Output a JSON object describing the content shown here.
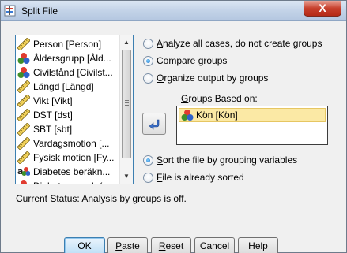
{
  "window": {
    "title": "Split File",
    "close_glyph": "X",
    "icon": "split-file-app-icon"
  },
  "variables": {
    "items": [
      {
        "label": "Person [Person]",
        "icon": "scale-ruler-icon"
      },
      {
        "label": "Åldersgrupp [Åld...",
        "icon": "nominal-icon"
      },
      {
        "label": "Civilstånd [Civilst...",
        "icon": "nominal-icon"
      },
      {
        "label": "Längd [Längd]",
        "icon": "scale-ruler-icon"
      },
      {
        "label": "Vikt [Vikt]",
        "icon": "scale-ruler-icon"
      },
      {
        "label": "DST [dst]",
        "icon": "scale-ruler-icon"
      },
      {
        "label": "SBT [sbt]",
        "icon": "scale-ruler-icon"
      },
      {
        "label": "Vardagsmotion [...",
        "icon": "scale-ruler-icon"
      },
      {
        "label": "Fysisk motion [Fy...",
        "icon": "scale-ruler-icon"
      },
      {
        "label": "Diabetes beräkn...",
        "icon": "string-nominal-icon"
      },
      {
        "label": "Diabetes orsak (...",
        "icon": "nominal-icon"
      }
    ]
  },
  "options": {
    "analyze_all": {
      "label": "nalyze all cases, do not create groups",
      "accel": "A",
      "checked": false
    },
    "compare": {
      "label": "ompare groups",
      "accel": "C",
      "checked": true
    },
    "organize": {
      "label": "rganize output by groups",
      "accel": "O",
      "checked": false
    }
  },
  "groups": {
    "label": "roups Based on:",
    "accel": "G",
    "items": [
      {
        "label": "Kön [Kön]",
        "icon": "nominal-icon"
      }
    ]
  },
  "sorting": {
    "sort_file": {
      "label": "ort the file by grouping variables",
      "accel": "S",
      "checked": true
    },
    "already_sorted": {
      "label": "ile is already sorted",
      "accel": "F",
      "checked": false
    }
  },
  "status_text": "Current Status: Analysis by groups is off.",
  "buttons": {
    "ok": "OK",
    "paste": {
      "accel": "P",
      "rest": "aste"
    },
    "reset": {
      "accel": "R",
      "rest": "eset"
    },
    "cancel": "Cancel",
    "help": "Help"
  },
  "colors": {
    "accent": "#3c7fb1",
    "selection": "#fbe9a5",
    "close": "#c7402c"
  }
}
